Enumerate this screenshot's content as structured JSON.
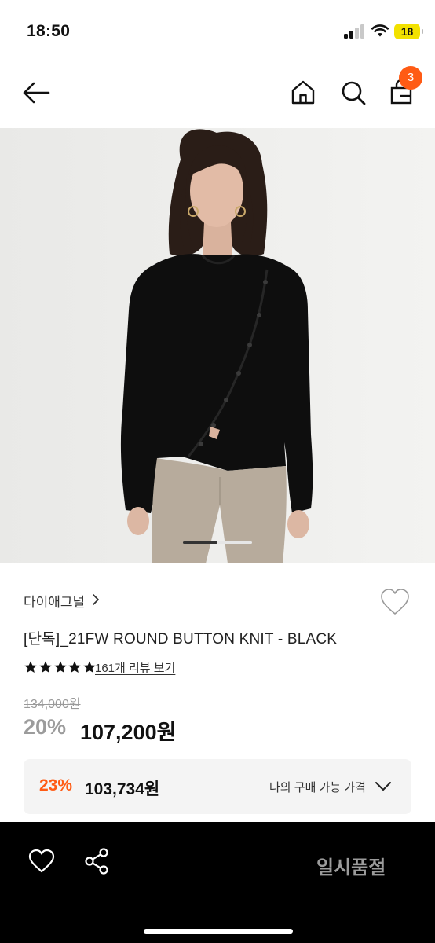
{
  "status_bar": {
    "time": "18:50",
    "battery": "18"
  },
  "header": {
    "icons": [
      "back-arrow-icon",
      "home-icon",
      "search-icon",
      "shopping-bag-icon"
    ],
    "cart_count": "3"
  },
  "product": {
    "image_alt": "",
    "image_count": 2,
    "current_image": 1,
    "brand": "다이애그널",
    "title": "[단독]_21FW ROUND BUTTON KNIT - BLACK",
    "rating_stars": 5,
    "review_link": "161개 리뷰 보기",
    "original_price": "134,000원",
    "discount_rate": "20%",
    "sale_price": "107,200원",
    "my_price": {
      "rate": "23%",
      "price": "103,734원",
      "label": "나의 구매 가능 가격"
    }
  },
  "bottom_bar": {
    "status_button": "일시품절"
  },
  "colors": {
    "accent": "#ff5b14",
    "bottom_bar": "#000000",
    "price_box": "#f4f4f4",
    "battery": "#f2e100"
  }
}
